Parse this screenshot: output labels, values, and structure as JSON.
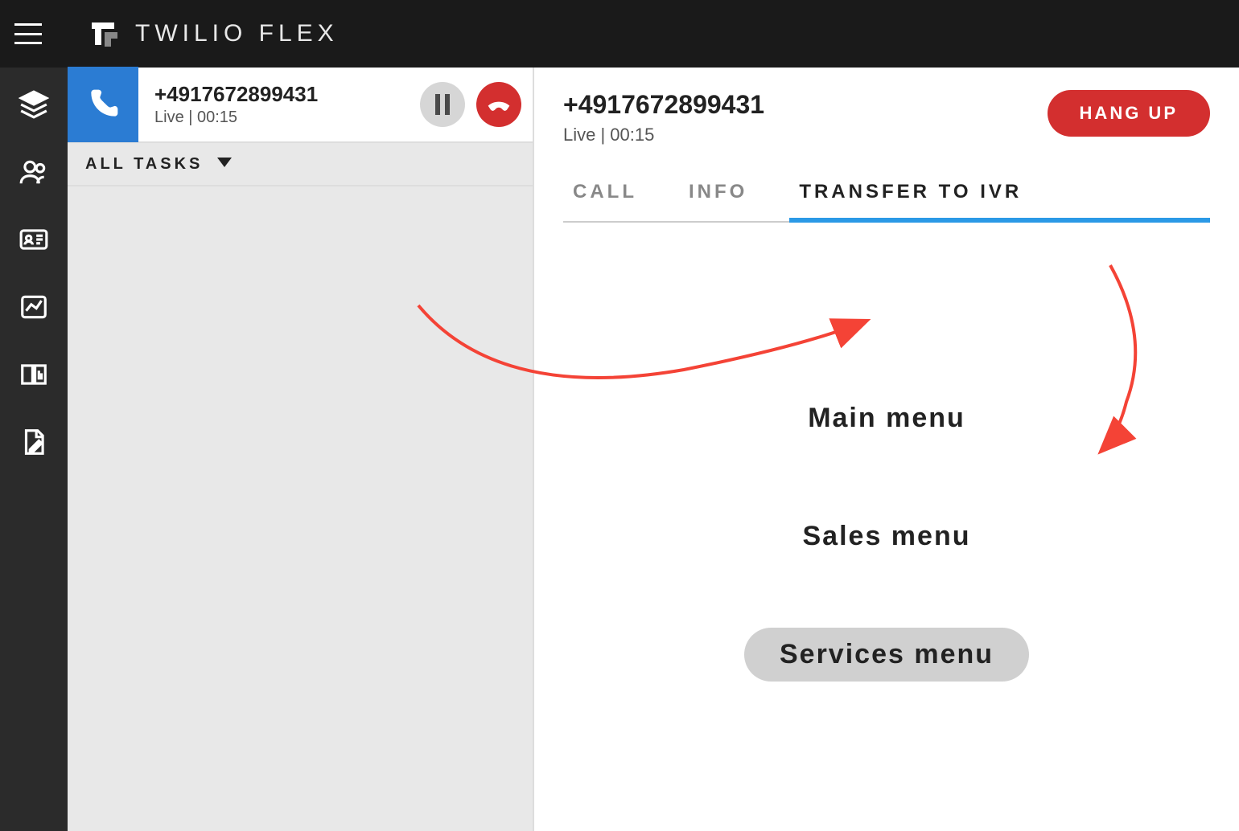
{
  "header": {
    "app_name": "TWILIO FLEX"
  },
  "task": {
    "phone": "+4917672899431",
    "status_line": "Live | 00:15"
  },
  "tasks_filter": {
    "label": "ALL TASKS"
  },
  "detail": {
    "phone": "+4917672899431",
    "status_line": "Live | 00:15",
    "hangup_label": "HANG UP",
    "tabs": {
      "call": "CALL",
      "info": "INFO",
      "transfer": "TRANSFER TO IVR"
    },
    "ivr_options": {
      "main": "Main menu",
      "sales": "Sales menu",
      "services": "Services menu"
    }
  },
  "colors": {
    "accent_blue": "#2b7cd3",
    "tab_underline": "#2b99e6",
    "danger": "#d32f2f",
    "sidenav_bg": "#2b2b2b",
    "annotation": "#f44336"
  }
}
